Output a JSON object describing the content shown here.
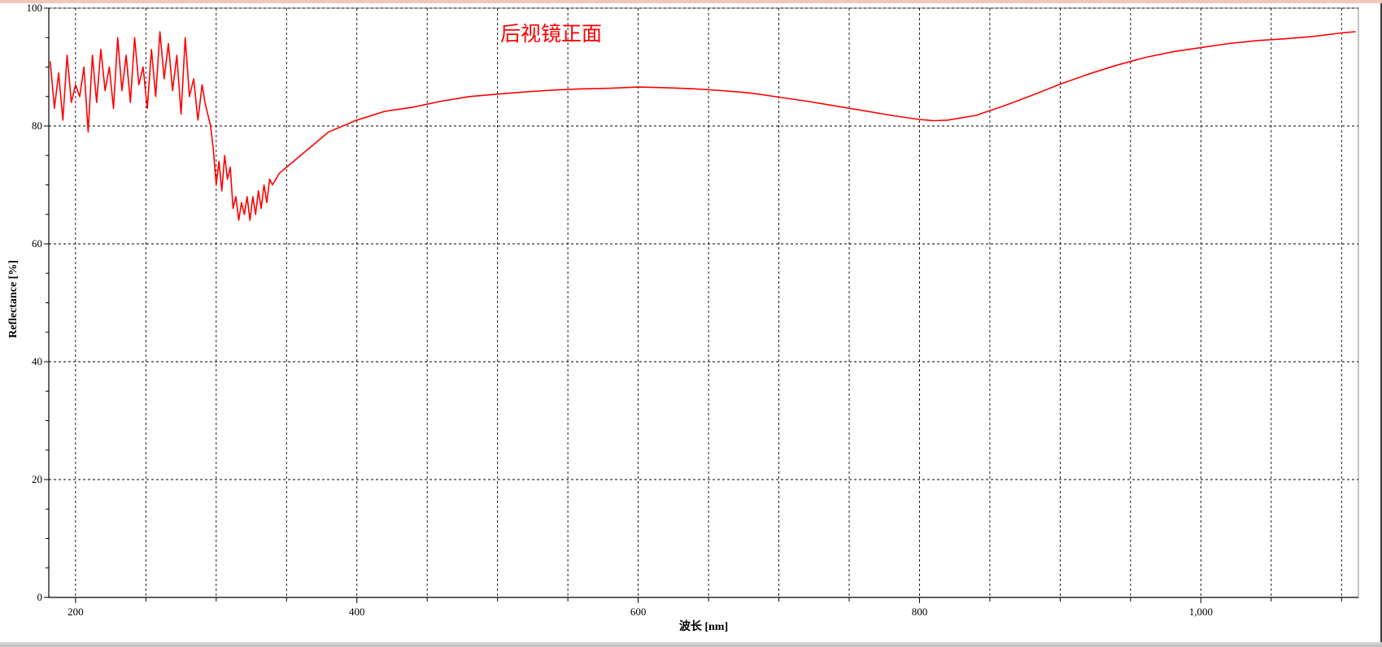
{
  "chart_data": {
    "type": "line",
    "title": "后视镜正面",
    "xlabel": "波长 [nm]",
    "ylabel": "Reflectance [%]",
    "xlim": [
      181,
      1112
    ],
    "ylim": [
      0,
      100
    ],
    "x_ticks": [
      200,
      400,
      600,
      800,
      1000
    ],
    "x_tick_labels": [
      "200",
      "400",
      "600",
      "800",
      "1,000"
    ],
    "y_ticks": [
      0,
      20,
      40,
      60,
      80,
      100
    ],
    "y_tick_labels": [
      "0",
      "20",
      "40",
      "60",
      "80",
      "100"
    ],
    "grid": true,
    "series": [
      {
        "color": "#ff0000",
        "x": [
          182,
          185,
          188,
          191,
          194,
          197,
          200,
          203,
          206,
          209,
          212,
          215,
          218,
          221,
          224,
          227,
          230,
          233,
          236,
          239,
          242,
          245,
          248,
          251,
          254,
          257,
          260,
          263,
          266,
          269,
          272,
          275,
          278,
          281,
          284,
          287,
          290,
          292,
          294,
          296,
          298,
          300,
          302,
          304,
          306,
          308,
          310,
          312,
          314,
          316,
          318,
          320,
          322,
          324,
          326,
          328,
          330,
          332,
          334,
          336,
          338,
          340,
          345,
          350,
          355,
          360,
          370,
          380,
          390,
          400,
          420,
          440,
          460,
          480,
          500,
          520,
          540,
          560,
          580,
          600,
          620,
          640,
          660,
          680,
          700,
          720,
          740,
          760,
          780,
          800,
          810,
          820,
          840,
          860,
          880,
          900,
          920,
          940,
          960,
          980,
          1000,
          1020,
          1040,
          1060,
          1080,
          1100,
          1110
        ],
        "y": [
          91,
          83,
          89,
          81,
          92,
          84,
          87,
          85,
          90,
          79,
          92,
          84,
          93,
          86,
          90,
          83,
          95,
          86,
          92,
          84,
          95,
          87,
          90,
          83,
          93,
          85,
          96,
          88,
          94,
          86,
          92,
          82,
          95,
          85,
          88,
          81,
          87,
          84,
          82,
          80,
          76,
          70,
          74,
          69,
          75,
          71,
          73,
          66,
          68,
          64,
          67,
          65,
          68,
          64,
          68,
          65,
          69,
          66,
          70,
          67,
          71,
          70,
          72,
          73,
          74,
          75,
          77,
          79,
          80,
          81,
          82.5,
          83.2,
          84.2,
          85,
          85.4,
          85.8,
          86.1,
          86.3,
          86.4,
          86.6,
          86.5,
          86.3,
          86,
          85.6,
          84.9,
          84.2,
          83.4,
          82.6,
          81.8,
          81.1,
          80.9,
          81,
          81.8,
          83.4,
          85.2,
          87.1,
          88.8,
          90.3,
          91.6,
          92.6,
          93.3,
          94,
          94.5,
          94.8,
          95.2,
          95.8,
          96
        ]
      }
    ]
  }
}
